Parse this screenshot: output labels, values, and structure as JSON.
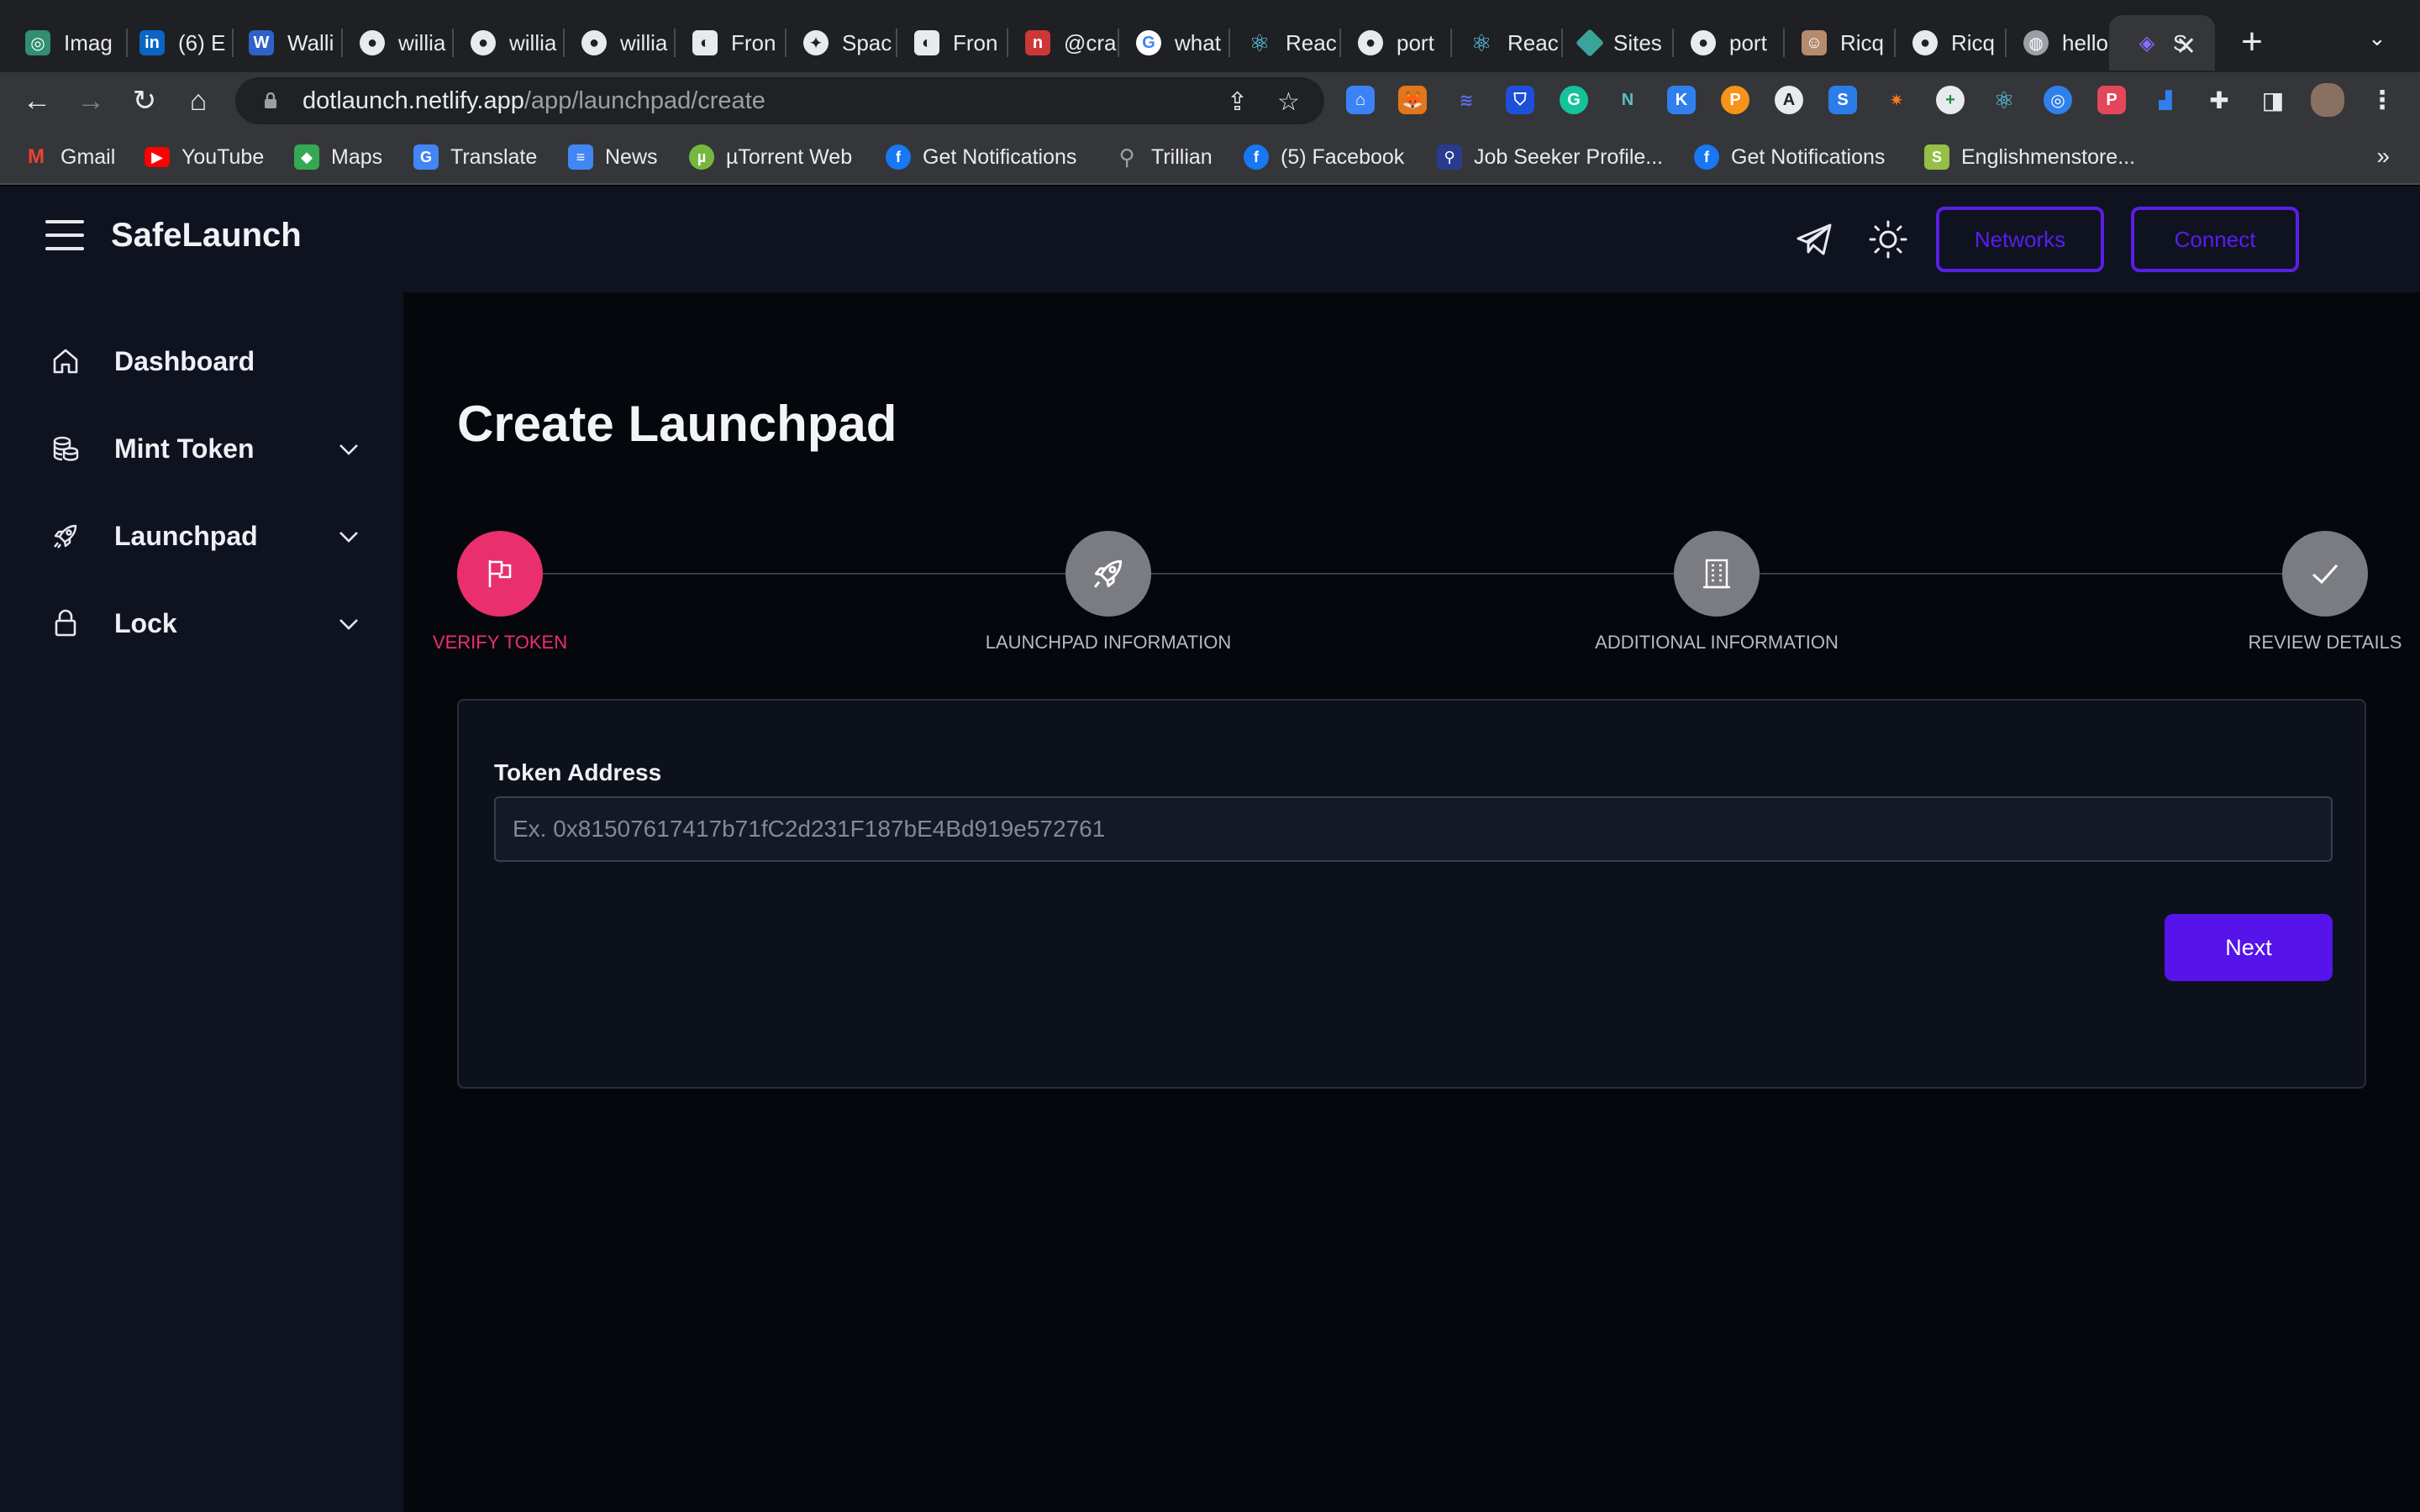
{
  "browser": {
    "tabs": [
      {
        "title": "Imag",
        "icon": "openai-icon",
        "color": "#2f8f6f"
      },
      {
        "title": "(6) E",
        "icon": "linkedin-icon",
        "color": "#0a66c2"
      },
      {
        "title": "Walli",
        "icon": "w-icon",
        "color": "#2f62c9"
      },
      {
        "title": "willia",
        "icon": "github-icon",
        "color": "#3a3b3f"
      },
      {
        "title": "willia",
        "icon": "github-icon",
        "color": "#3a3b3f"
      },
      {
        "title": "willia",
        "icon": "github-icon",
        "color": "#3a3b3f"
      },
      {
        "title": "Fron",
        "icon": "frontend-icon",
        "color": "#e8eaed"
      },
      {
        "title": "Spac",
        "icon": "spaces-icon",
        "color": "#e8eaed"
      },
      {
        "title": "Fron",
        "icon": "frontend-icon",
        "color": "#e8eaed"
      },
      {
        "title": "@cra",
        "icon": "npm-icon",
        "color": "#cb3837"
      },
      {
        "title": "what",
        "icon": "google-icon",
        "color": "#ffffff"
      },
      {
        "title": "Reac",
        "icon": "react-icon",
        "color": "#61dafb"
      },
      {
        "title": "port",
        "icon": "github-icon",
        "color": "#3a3b3f"
      },
      {
        "title": "Reac",
        "icon": "react-icon",
        "color": "#61dafb"
      },
      {
        "title": "Sites",
        "icon": "sites-icon",
        "color": "#3aa39a"
      },
      {
        "title": "port",
        "icon": "github-icon",
        "color": "#3a3b3f"
      },
      {
        "title": "Ricq",
        "icon": "avatar-icon",
        "color": "#b58b6f"
      },
      {
        "title": "Ricq",
        "icon": "github-icon",
        "color": "#3a3b3f"
      },
      {
        "title": "hello",
        "icon": "globe-icon",
        "color": "#9aa0a6"
      },
      {
        "title": "S",
        "icon": "safelaunch-icon",
        "color": "#8a6cff"
      }
    ],
    "address": {
      "host": "dotlaunch.netlify.app",
      "path": "/app/launchpad/create"
    },
    "bookmarks": [
      {
        "label": "Gmail",
        "icon": "gmail-icon",
        "color": "#ea4335"
      },
      {
        "label": "YouTube",
        "icon": "youtube-icon",
        "color": "#ff0000"
      },
      {
        "label": "Maps",
        "icon": "maps-icon",
        "color": "#34a853"
      },
      {
        "label": "Translate",
        "icon": "translate-icon",
        "color": "#4285f4"
      },
      {
        "label": "News",
        "icon": "news-icon",
        "color": "#4285f4"
      },
      {
        "label": "µTorrent Web",
        "icon": "utorrent-icon",
        "color": "#76b83f"
      },
      {
        "label": "Get Notifications",
        "icon": "facebook-icon",
        "color": "#1877f2"
      },
      {
        "label": "Trillian",
        "icon": "trillian-icon",
        "color": "#9aa0a6"
      },
      {
        "label": "(5) Facebook",
        "icon": "facebook-icon",
        "color": "#1877f2"
      },
      {
        "label": "Job Seeker Profile...",
        "icon": "job-seeker-icon",
        "color": "#2a3b8f"
      },
      {
        "label": "Get Notifications",
        "icon": "facebook-icon",
        "color": "#1877f2"
      },
      {
        "label": "Englishmenstore...",
        "icon": "shopify-icon",
        "color": "#95bf47"
      }
    ],
    "more_bookmarks": "»"
  },
  "app": {
    "brand": "SafeLaunch",
    "networks_label": "Networks",
    "connect_label": "Connect",
    "accent": "#5613ea",
    "sidebar": [
      {
        "label": "Dashboard",
        "icon": "home-icon",
        "has_children": false
      },
      {
        "label": "Mint Token",
        "icon": "coins-icon",
        "has_children": true
      },
      {
        "label": "Launchpad",
        "icon": "rocket-icon",
        "has_children": true
      },
      {
        "label": "Lock",
        "icon": "lock-icon",
        "has_children": true
      }
    ],
    "page_title": "Create Launchpad",
    "steps": [
      {
        "label": "VERIFY TOKEN",
        "icon": "flag-icon",
        "active": true
      },
      {
        "label": "LAUNCHPAD INFORMATION",
        "icon": "rocket-icon",
        "active": false
      },
      {
        "label": "ADDITIONAL INFORMATION",
        "icon": "building-icon",
        "active": false
      },
      {
        "label": "REVIEW DETAILS",
        "icon": "check-icon",
        "active": false
      }
    ],
    "step_active_color": "#e92f6d",
    "form": {
      "token_address_label": "Token Address",
      "token_address_value": "",
      "token_address_placeholder": "Ex. 0x81507617417b71fC2d231F187bE4Bd919e572761",
      "next_label": "Next"
    }
  }
}
